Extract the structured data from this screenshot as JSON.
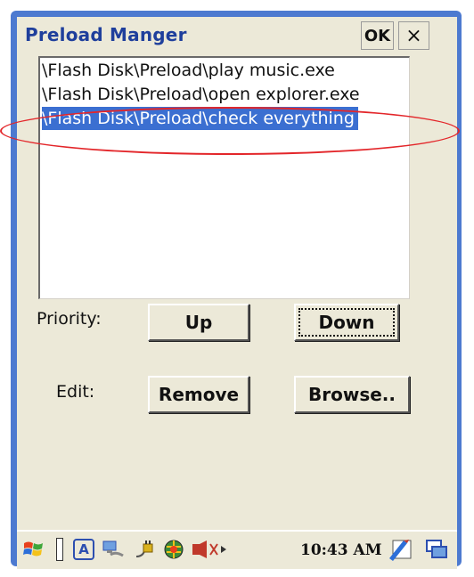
{
  "window": {
    "title": "Preload Manger",
    "ok_label": "OK",
    "close_label": "×"
  },
  "preload_list": {
    "items": [
      {
        "path": "\\Flash Disk\\Preload\\play music.exe",
        "selected": false
      },
      {
        "path": "\\Flash Disk\\Preload\\open explorer.exe",
        "selected": false
      },
      {
        "path": "\\Flash Disk\\Preload\\check everything",
        "selected": true
      }
    ]
  },
  "priority": {
    "label": "Priority:",
    "up_label": "Up",
    "down_label": "Down"
  },
  "edit": {
    "label": "Edit:",
    "remove_label": "Remove",
    "browse_label": "Browse.."
  },
  "taskbar": {
    "clock": "10:43 AM",
    "input_method": "A",
    "icons": [
      "start-flag-icon",
      "separator-icon",
      "input-mode-icon",
      "network-icon",
      "power-plug-icon",
      "globe-icon",
      "volume-icon",
      "input-panel-icon",
      "desktop-icon"
    ]
  },
  "colors": {
    "selection": "#3b6fd1",
    "title_text": "#1f3f9c",
    "frame": "#4d7ad0",
    "annotation": "#e3262a"
  }
}
